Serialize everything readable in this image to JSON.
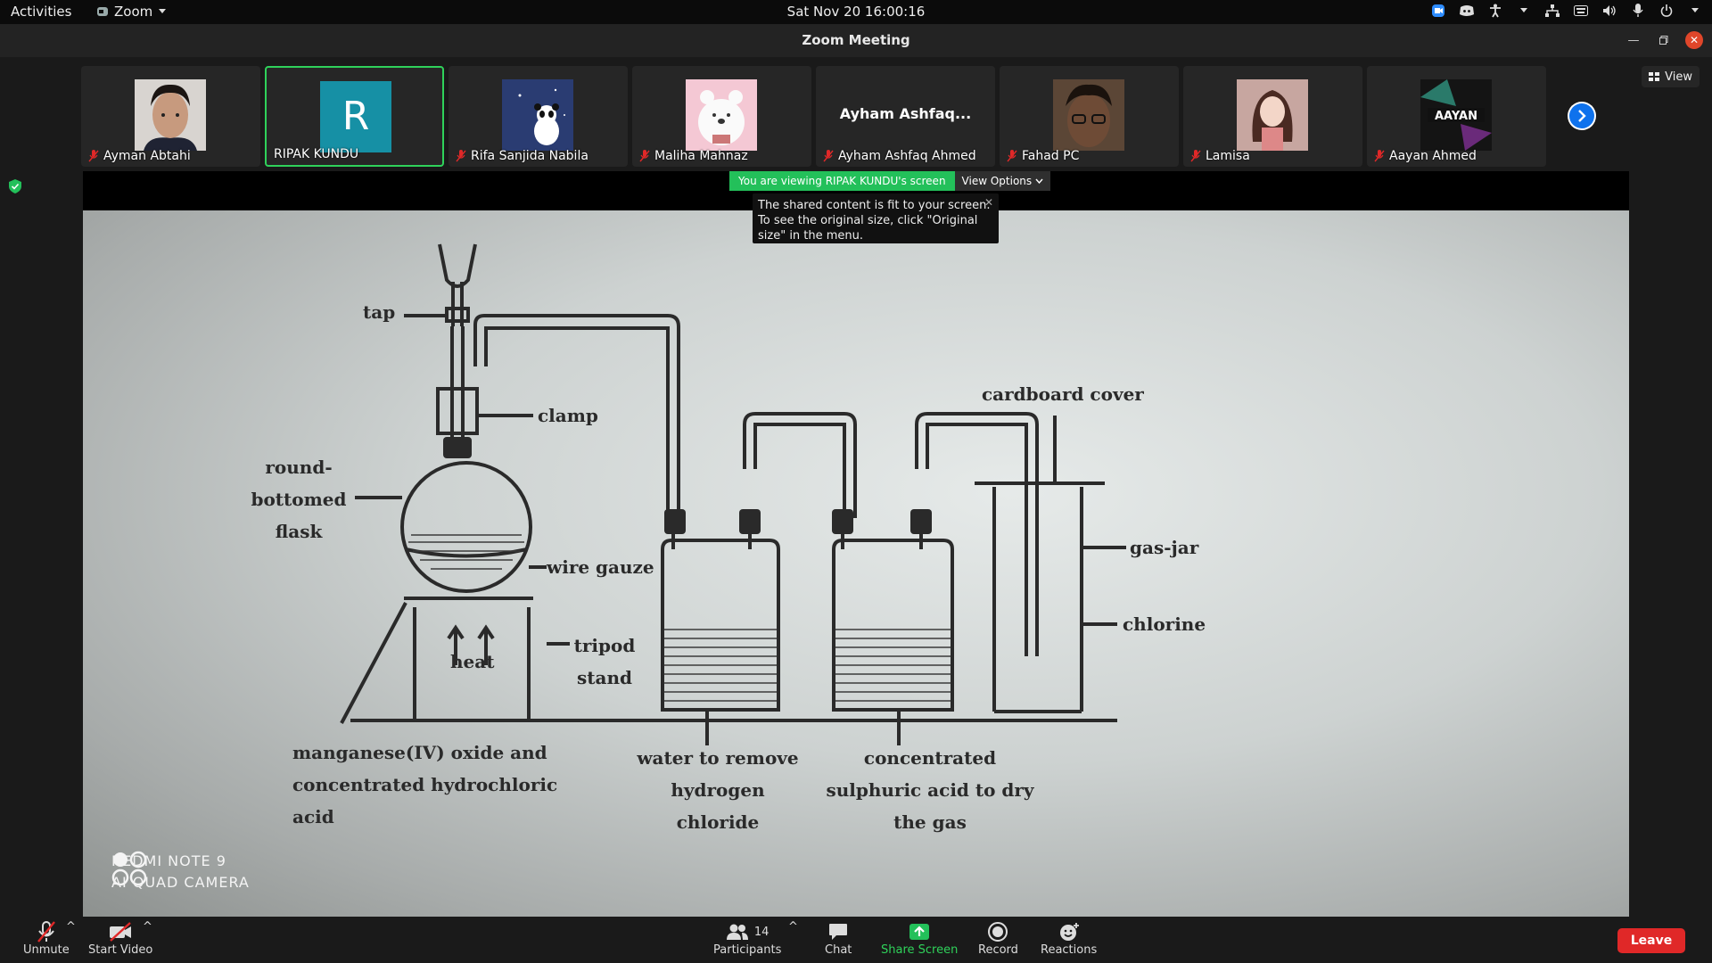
{
  "topbar": {
    "activities": "Activities",
    "app_name": "Zoom",
    "clock": "Sat Nov 20  16:00:16"
  },
  "window": {
    "title": "Zoom Meeting"
  },
  "view_button": "View",
  "participants_strip": [
    {
      "name": "Ayman Abtahi",
      "type": "photo"
    },
    {
      "name": "RIPAK KUNDU",
      "type": "initial",
      "initial": "R",
      "active": true
    },
    {
      "name": "Rifa Sanjida Nabila",
      "type": "photo"
    },
    {
      "name": "Maliha Mahnaz",
      "type": "photo"
    },
    {
      "name": "Ayham Ashfaq Ahmed",
      "type": "name",
      "display": "Ayham Ashfaq..."
    },
    {
      "name": "Fahad PC",
      "type": "photo"
    },
    {
      "name": "Lamisa",
      "type": "photo"
    },
    {
      "name": "Aayan Ahmed",
      "type": "photo",
      "avatar_text": "AAYAN"
    }
  ],
  "share": {
    "banner": "You are viewing RIPAK KUNDU's screen",
    "view_options": "View Options",
    "tooltip": "The shared content is fit to your screen. To see the original size, click \"Original size\" in the menu."
  },
  "diagram": {
    "labels": {
      "tap": "tap",
      "clamp": "clamp",
      "flask": "round-bottomed flask",
      "gauze": "wire gauze",
      "heat": "heat",
      "tripod": "tripod stand",
      "cardboard": "cardboard cover",
      "gasjar": "gas-jar",
      "chlorine": "chlorine",
      "reagents": "manganese(IV) oxide and concentrated hydrochloric acid",
      "water": "water to remove hydrogen chloride",
      "acid": "concentrated sulphuric acid to dry the gas"
    },
    "watermark_line1": "REDMI NOTE 9",
    "watermark_line2": "AI QUAD CAMERA"
  },
  "toolbar": {
    "unmute": "Unmute",
    "start_video": "Start Video",
    "participants": "Participants",
    "participants_count": "14",
    "chat": "Chat",
    "share_screen": "Share Screen",
    "record": "Record",
    "reactions": "Reactions",
    "leave": "Leave"
  },
  "colors": {
    "zoom_blue": "#0e72ed",
    "share_green": "#23c05a",
    "leave_red": "#e02828",
    "active_border": "#2fd25a"
  }
}
